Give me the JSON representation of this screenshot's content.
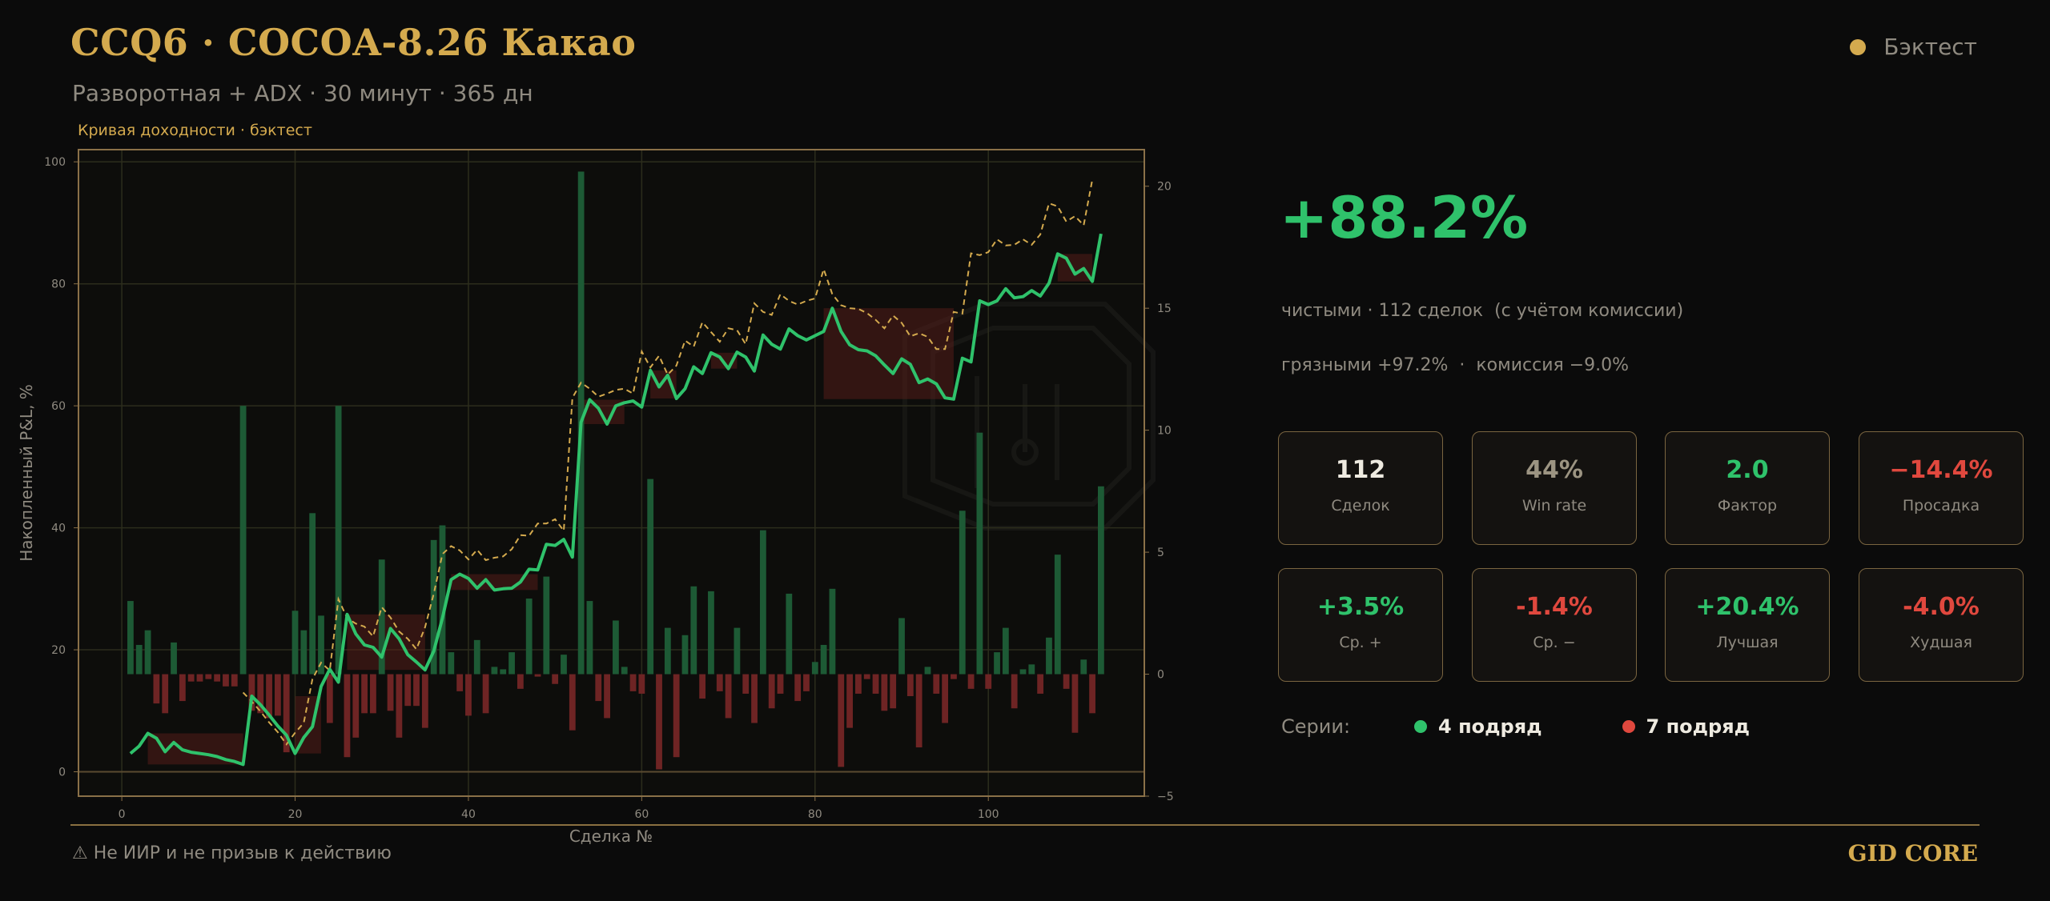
{
  "header": {
    "title": "CCQ6 · COCOA-8.26 Какао",
    "subtitle": "Разворотная + ADX · 30 минут · 365 дн",
    "status_label": "Бэктест"
  },
  "chart_data": {
    "type": "line",
    "title": "Кривая доходности · бэктест",
    "xlabel": "Сделка №",
    "ylabel": "Накопленный P&L, %",
    "xlim": [
      -5,
      118
    ],
    "ylim": [
      -4,
      102
    ],
    "y2lim": [
      -5,
      21.5
    ],
    "xticks": [
      0,
      20,
      40,
      60,
      80,
      100
    ],
    "yticks": [
      0,
      20,
      40,
      60,
      80,
      100
    ],
    "y2ticks": [
      -5,
      0,
      5,
      10,
      15,
      20
    ],
    "grid": true,
    "colors": {
      "net": "#2fc26b",
      "gross": "#d4aa4e",
      "bar_pos": "#1d5a35",
      "bar_neg": "#6e2424",
      "drawdown": "#5a1e1a"
    },
    "series": [
      {
        "role": "net",
        "style": "solid",
        "x_start": 1,
        "values": [
          3.0,
          4.2,
          6.3,
          5.5,
          3.3,
          4.8,
          3.6,
          3.2,
          3.0,
          2.8,
          2.5,
          2.0,
          1.7,
          1.2,
          12.4,
          11.0,
          9.3,
          7.5,
          6.0,
          3.0,
          5.6,
          7.4,
          14.0,
          16.8,
          14.7,
          25.8,
          22.6,
          20.8,
          20.4,
          18.8,
          23.5,
          21.8,
          19.2,
          18.0,
          16.7,
          19.8,
          25.2,
          31.5,
          32.4,
          31.7,
          30.1,
          31.5,
          29.8,
          30.0,
          30.1,
          31.1,
          33.2,
          33.1,
          37.3,
          37.1,
          38.1,
          35.2,
          57.3,
          61.0,
          59.6,
          57.0,
          60.0,
          60.5,
          60.8,
          59.8,
          65.8,
          63.1,
          65.0,
          61.2,
          62.8,
          66.4,
          65.3,
          68.7,
          68.0,
          66.1,
          68.8,
          68.0,
          65.7,
          71.6,
          70.1,
          69.3,
          72.6,
          71.5,
          70.8,
          71.5,
          72.2,
          76.0,
          72.2,
          70.0,
          69.2,
          69.0,
          68.2,
          66.7,
          65.3,
          67.7,
          66.8,
          63.8,
          64.4,
          63.6,
          61.3,
          61.1,
          67.8,
          67.2,
          77.2,
          76.6,
          77.2,
          79.2,
          77.7,
          77.9,
          78.9,
          78.0,
          80.1,
          84.9,
          84.2,
          81.6,
          82.5,
          80.4,
          88.2
        ]
      },
      {
        "role": "gross",
        "style": "dashed",
        "x_start": 14,
        "values": [
          13.0,
          11.5,
          9.9,
          8.1,
          6.5,
          4.5,
          6.4,
          8.0,
          15.2,
          17.9,
          16.6,
          28.3,
          25.2,
          24.3,
          23.8,
          22.2,
          27.0,
          25.3,
          23.0,
          21.8,
          20.1,
          23.7,
          29.2,
          35.7,
          37.0,
          36.3,
          34.8,
          36.4,
          34.7,
          35.1,
          35.3,
          36.5,
          38.8,
          38.7,
          40.7,
          40.7,
          41.4,
          39.5,
          61.3,
          63.8,
          62.8,
          61.5,
          62.0,
          62.6,
          62.8,
          62.0,
          68.9,
          66.3,
          68.2,
          65.1,
          66.6,
          70.7,
          69.7,
          73.7,
          72.1,
          70.5,
          72.7,
          72.4,
          70.1,
          76.8,
          75.4,
          74.9,
          78.3,
          77.2,
          76.6,
          77.2,
          77.6,
          82.4,
          78.3,
          76.5,
          76.0,
          75.9,
          75.2,
          74.1,
          72.7,
          74.8,
          73.6,
          71.4,
          71.9,
          71.3,
          69.3,
          69.3,
          75.4,
          75.1,
          85.0,
          84.7,
          85.2,
          87.3,
          86.3,
          86.4,
          87.3,
          86.4,
          88.1,
          93.2,
          92.7,
          90.2,
          91.1,
          89.6,
          97.1
        ]
      },
      {
        "role": "trade_bars",
        "axis": "secondary",
        "x_start": 1,
        "values": [
          3.0,
          1.2,
          1.8,
          -1.2,
          -1.6,
          1.3,
          -1.1,
          -0.3,
          -0.3,
          -0.2,
          -0.3,
          -0.5,
          -0.5,
          11.0,
          -1.5,
          -1.6,
          -1.8,
          -1.7,
          -3.2,
          2.6,
          1.8,
          6.6,
          2.4,
          -2.0,
          11.0,
          -3.4,
          -2.6,
          -1.6,
          -1.6,
          4.7,
          -1.5,
          -2.6,
          -1.3,
          -1.3,
          -2.2,
          5.5,
          6.1,
          0.9,
          -0.7,
          -1.7,
          1.4,
          -1.6,
          0.3,
          0.2,
          0.9,
          -0.6,
          3.1,
          -0.1,
          4.0,
          -0.4,
          0.8,
          -2.3,
          20.6,
          3.0,
          -1.1,
          -1.8,
          2.2,
          0.3,
          -0.7,
          -0.8,
          8.0,
          -3.9,
          1.9,
          -3.4,
          1.6,
          3.6,
          -1.0,
          3.4,
          -0.7,
          -1.8,
          1.9,
          -0.8,
          -2.0,
          5.9,
          -1.4,
          -0.8,
          3.3,
          -1.1,
          -0.7,
          0.5,
          1.2,
          3.5,
          -3.8,
          -2.2,
          -0.8,
          -0.2,
          -0.8,
          -1.5,
          -1.4,
          2.3,
          -0.9,
          -3.0,
          0.3,
          -0.8,
          -2.0,
          -0.2,
          6.7,
          -0.6,
          9.9,
          -0.6,
          0.9,
          1.9,
          -1.4,
          0.2,
          0.4,
          -0.8,
          1.5,
          4.9,
          -0.6,
          -2.4,
          0.6,
          -1.6,
          7.7
        ]
      }
    ],
    "drawdown_zones": [
      {
        "x0": 3,
        "x1": 14,
        "peak": 6.3
      },
      {
        "x0": 20,
        "x1": 23,
        "peak": 12.4
      },
      {
        "x0": 26,
        "x1": 35,
        "peak": 25.8
      },
      {
        "x0": 38,
        "x1": 48,
        "peak": 32.4
      },
      {
        "x0": 53,
        "x1": 58,
        "peak": 61.0
      },
      {
        "x0": 61,
        "x1": 64,
        "peak": 65.8
      },
      {
        "x0": 68,
        "x1": 71,
        "peak": 68.7
      },
      {
        "x0": 81,
        "x1": 96,
        "peak": 76.0
      },
      {
        "x0": 108,
        "x1": 112,
        "peak": 84.9
      }
    ]
  },
  "summary": {
    "total_return": "+88.2%",
    "net_line": "чистыми · 112 сделок  (с учётом комиссии)",
    "gross_line": "грязными +97.2%  ·  комиссия −9.0%"
  },
  "stats": [
    {
      "value": "112",
      "label": "Сделок",
      "color": "#eeeae0"
    },
    {
      "value": "44%",
      "label": "Win rate",
      "color": "#9c9482"
    },
    {
      "value": "2.0",
      "label": "Фактор",
      "color": "#2fc26b"
    },
    {
      "value": "−14.4%",
      "label": "Просадка",
      "color": "#e0483e"
    },
    {
      "value": "+3.5%",
      "label": "Ср. +",
      "color": "#2fc26b"
    },
    {
      "value": "-1.4%",
      "label": "Ср. −",
      "color": "#e0483e"
    },
    {
      "value": "+20.4%",
      "label": "Лучшая",
      "color": "#2fc26b"
    },
    {
      "value": "-4.0%",
      "label": "Худшая",
      "color": "#e0483e"
    }
  ],
  "streaks": {
    "label": "Серии:",
    "win": {
      "text": "4 подряд",
      "color": "#2fc26b"
    },
    "loss": {
      "text": "7 подряд",
      "color": "#e0483e"
    }
  },
  "footer": {
    "disclaimer": "⚠ Не ИИР и не призыв к действию",
    "brand": "GID CORE"
  }
}
